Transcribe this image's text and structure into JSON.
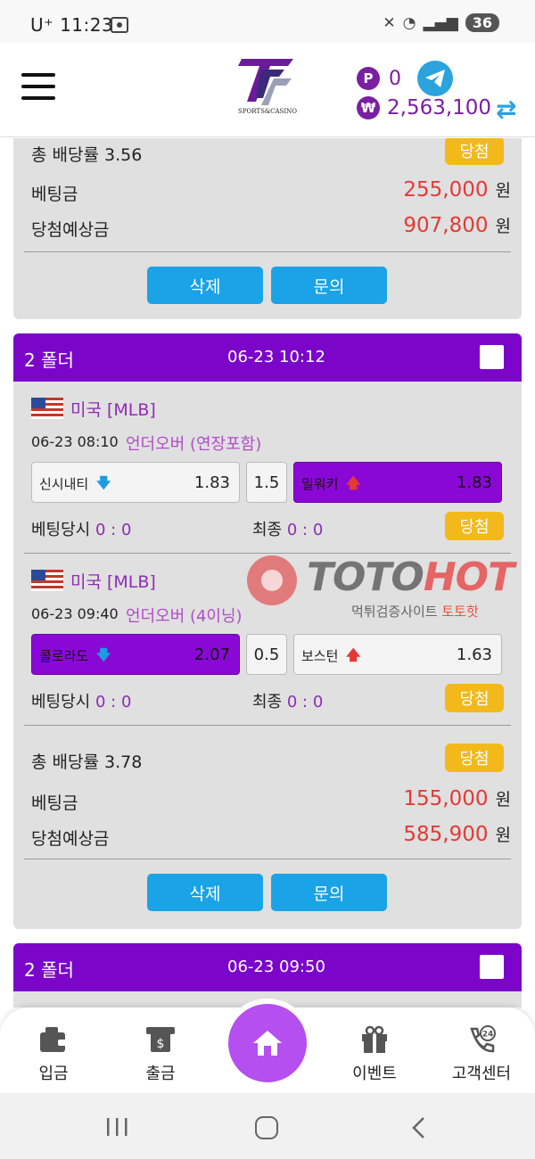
{
  "status_bar": {
    "carrier": "U⁺",
    "time": "11:23",
    "battery": "36"
  },
  "header": {
    "logo_sub": "SPORTS&CASINO",
    "point_badge": "P",
    "point_value": "0",
    "won_badge": "₩",
    "balance": "2,563,100",
    "accent_color": "#7a1fa2"
  },
  "card_top": {
    "total_odds": "총 배당률 3.56",
    "status": "당첨",
    "bet_label": "베팅금",
    "bet_amount": "255,000",
    "win_label": "당첨예상금",
    "win_amount": "907,800",
    "currency": "원",
    "delete_label": "삭제",
    "inquiry_label": "문의"
  },
  "card_main": {
    "folder": "2 폴더",
    "datetime": "06-23 10:12",
    "games": [
      {
        "league": "미국 [MLB]",
        "time": "06-23 08:10",
        "type": "언더오버 (연장포함)",
        "home": "신시내티",
        "home_arrow": "🡇",
        "home_odds": "1.83",
        "line": "1.5",
        "away": "밀워키",
        "away_arrow": "🡅",
        "away_odds": "1.83",
        "bet_label": "베팅당시",
        "bet_score": "0 : 0",
        "final_label": "최종",
        "final_score": "0 : 0",
        "status": "당첨"
      },
      {
        "league": "미국 [MLB]",
        "time": "06-23 09:40",
        "type": "언더오버 (4이닝)",
        "home": "콜로라도",
        "home_arrow": "🡇",
        "home_odds": "2.07",
        "line": "0.5",
        "away": "보스턴",
        "away_arrow": "🡅",
        "away_odds": "1.63",
        "bet_label": "베팅당시",
        "bet_score": "0 : 0",
        "final_label": "최종",
        "final_score": "0 : 0",
        "status": "당첨"
      }
    ],
    "total_odds": "총 배당률 3.78",
    "status": "당첨",
    "bet_label": "베팅금",
    "bet_amount": "155,000",
    "win_label": "당첨예상금",
    "win_amount": "585,900",
    "currency": "원",
    "delete_label": "삭제",
    "inquiry_label": "문의"
  },
  "card_next": {
    "folder": "2 폴더",
    "datetime": "06-23 09:50"
  },
  "watermark": {
    "brand_a": "TOTO",
    "brand_b": "HOT",
    "sub_a": "먹튀검증사이트 ",
    "sub_b": "토토핫"
  },
  "bottom_nav": {
    "deposit": "입금",
    "withdraw": "출금",
    "event": "이벤트",
    "support": "고객센터",
    "support_badge": "24"
  }
}
